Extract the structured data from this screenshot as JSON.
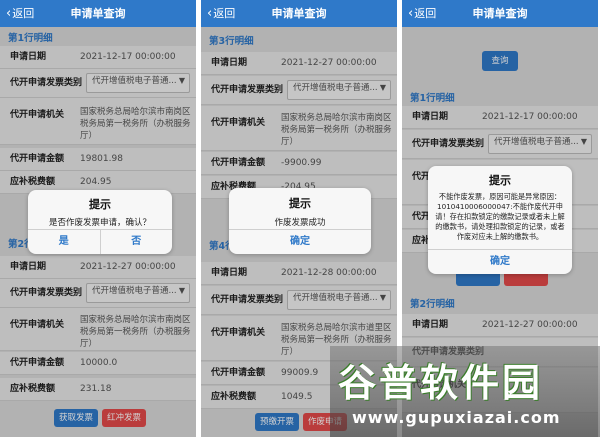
{
  "nav": {
    "back_label": "返回",
    "title": "申请单查询"
  },
  "labels": {
    "apply_date": "申请日期",
    "invoice_type": "代开申请发票类别",
    "authority": "代开申请机关",
    "amount": "代开申请金额",
    "tax_due": "应补税费额"
  },
  "common": {
    "invoice_type_value": "代开增值税电子普通...",
    "authority_value": "国家税务总局哈尔滨市南岗区税务局第一税务所（办税服务厅）"
  },
  "panel1": {
    "section_title": "第1行明细",
    "date": "2021-12-17 00:00:00",
    "amount": "19801.98",
    "tax_due": "204.95",
    "section2_title": "第2行明细",
    "date2": "2021-12-27 00:00:00",
    "amount2": "10000.0",
    "tax_due2": "231.18",
    "btn_get_invoice": "获取发票",
    "btn_red_invoice": "红冲发票",
    "dialog": {
      "title": "提示",
      "message": "是否作废发票申请，确认？",
      "yes": "是",
      "no": "否"
    }
  },
  "panel2": {
    "section_title": "第3行明细",
    "date": "2021-12-27 00:00:00",
    "amount": "-9900.99",
    "tax_due": "-204.95",
    "section2_title": "第4行明细",
    "date2": "2021-12-28 00:00:00",
    "authority_value2": "国家税务总局哈尔滨市道里区税务局第一税务所（办税服务厅）",
    "amount2": "99009.9",
    "tax_due2": "1049.5",
    "btn_preview": "预缴开票",
    "btn_void": "作废申请",
    "dialog": {
      "title": "提示",
      "message": "作废发票成功",
      "ok": "确定"
    }
  },
  "panel3": {
    "query_button": "查询",
    "section_title": "第1行明细",
    "date": "2021-12-17 00:00:00",
    "section2_title": "第2行明细",
    "date2": "2021-12-27 00:00:00",
    "dialog": {
      "title": "提示",
      "message": "不能作废发票，原因可能是异常原因：1010410006000047:不能作废代开申请！存在扣款锁定的缴款记录或者未上解的缴款书，请处理扣款锁定的记录，或者作废对应未上解的缴款书。",
      "ok": "确定"
    }
  },
  "watermark": {
    "cn": "谷普软件园",
    "en": "www.gupuxiazai.com"
  },
  "colors": {
    "nav": "#2f79c9",
    "accent": "#2f79c9",
    "danger": "#e34a4a",
    "row_bg": "#e8e8e8"
  }
}
